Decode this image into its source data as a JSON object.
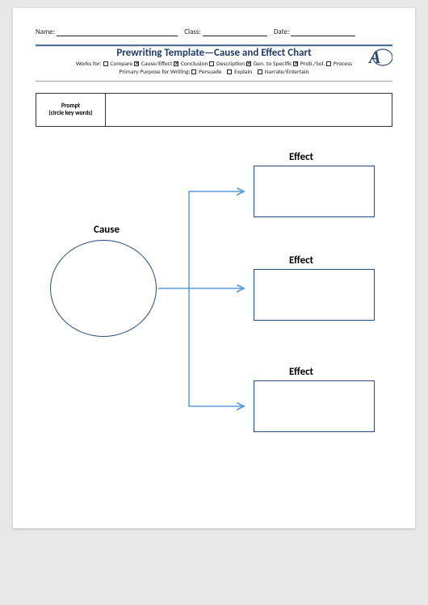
{
  "header": {
    "name_label": "Name:",
    "class_label": "Class:",
    "date_label": "Date:",
    "name_value": "",
    "class_value": "",
    "date_value": ""
  },
  "title": "Prewriting Template—Cause and Effect Chart",
  "works_for": {
    "prefix": "Works for:",
    "items": [
      {
        "label": "Compare",
        "checked": false
      },
      {
        "label": "Cause/Effect",
        "checked": true
      },
      {
        "label": "Conclusion",
        "checked": true
      },
      {
        "label": "Description",
        "checked": false
      },
      {
        "label": "Gen. to Specific",
        "checked": true
      },
      {
        "label": "Prob./Sol.",
        "checked": true
      },
      {
        "label": "Process",
        "checked": false
      }
    ]
  },
  "purpose": {
    "prefix": "Primary Purpose for Writing:",
    "items": [
      {
        "label": "Persuade",
        "checked": false
      },
      {
        "label": "Explain",
        "checked": false
      },
      {
        "label": "Narrate/Entertain",
        "checked": false
      }
    ]
  },
  "prompt": {
    "title": "Prompt",
    "subtitle": "(circle key words)",
    "value": ""
  },
  "diagram": {
    "cause_label": "Cause",
    "cause_value": "",
    "effects": [
      {
        "label": "Effect",
        "value": ""
      },
      {
        "label": "Effect",
        "value": ""
      },
      {
        "label": "Effect",
        "value": ""
      }
    ]
  },
  "logo_text": "A"
}
